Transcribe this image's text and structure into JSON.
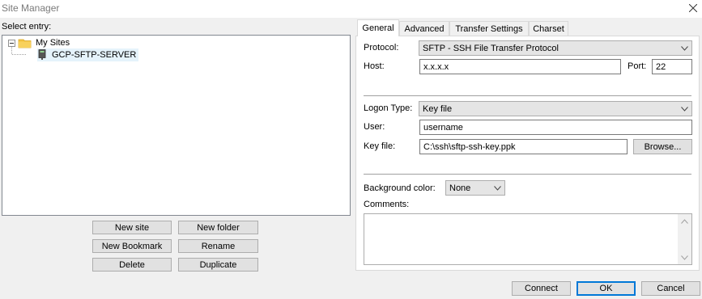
{
  "window": {
    "title": "Site Manager"
  },
  "left": {
    "select_entry_label": "Select entry:",
    "tree": {
      "root_label": "My Sites",
      "sites": [
        {
          "label": "GCP-SFTP-SERVER"
        }
      ]
    },
    "buttons": {
      "new_site": "New site",
      "new_folder": "New folder",
      "new_bookmark": "New Bookmark",
      "rename": "Rename",
      "delete": "Delete",
      "duplicate": "Duplicate"
    }
  },
  "tabs": [
    {
      "label": "General",
      "active": true
    },
    {
      "label": "Advanced",
      "active": false
    },
    {
      "label": "Transfer Settings",
      "active": false
    },
    {
      "label": "Charset",
      "active": false
    }
  ],
  "general": {
    "protocol_label": "Protocol:",
    "protocol_value": "SFTP - SSH File Transfer Protocol",
    "host_label": "Host:",
    "host_value": "x.x.x.x",
    "port_label": "Port:",
    "port_value": "22",
    "logon_type_label": "Logon Type:",
    "logon_type_value": "Key file",
    "user_label": "User:",
    "user_value": "username",
    "key_file_label": "Key file:",
    "key_file_value": "C:\\ssh\\sftp-ssh-key.ppk",
    "browse_label": "Browse...",
    "bg_color_label": "Background color:",
    "bg_color_value": "None",
    "comments_label": "Comments:",
    "comments_value": ""
  },
  "footer": {
    "connect": "Connect",
    "ok": "OK",
    "cancel": "Cancel"
  },
  "colors": {
    "dialog_bg": "#f0f0f0",
    "folder": "#f3c443",
    "default_button_border": "#0078d7"
  }
}
